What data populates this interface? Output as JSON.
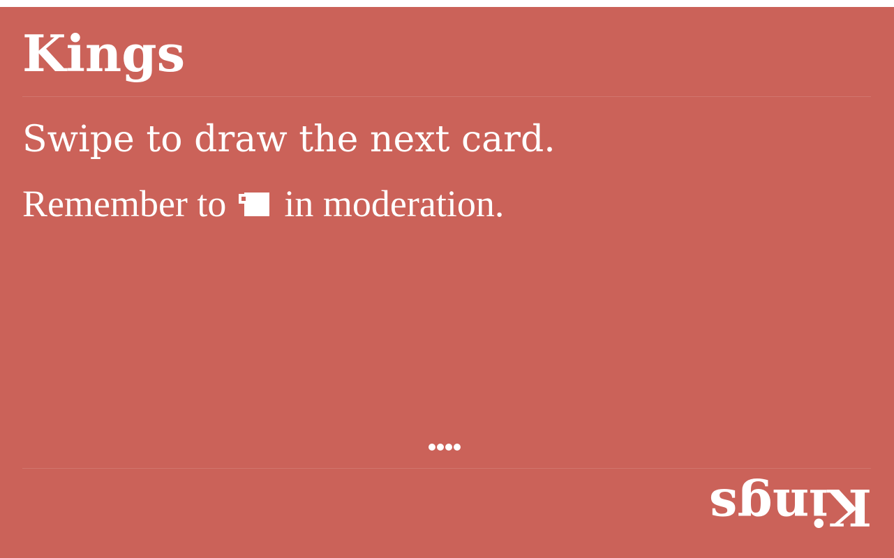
{
  "card": {
    "title": "Kings",
    "instruction": "Swipe to draw the next card.",
    "reminder_prefix": "Remember to",
    "reminder_icon": "drink-cup-icon",
    "reminder_suffix": "in moderation.",
    "title_flipped": "Kings",
    "page_dots": 4,
    "background_color": "#cb6259",
    "text_color": "#ffffff"
  }
}
